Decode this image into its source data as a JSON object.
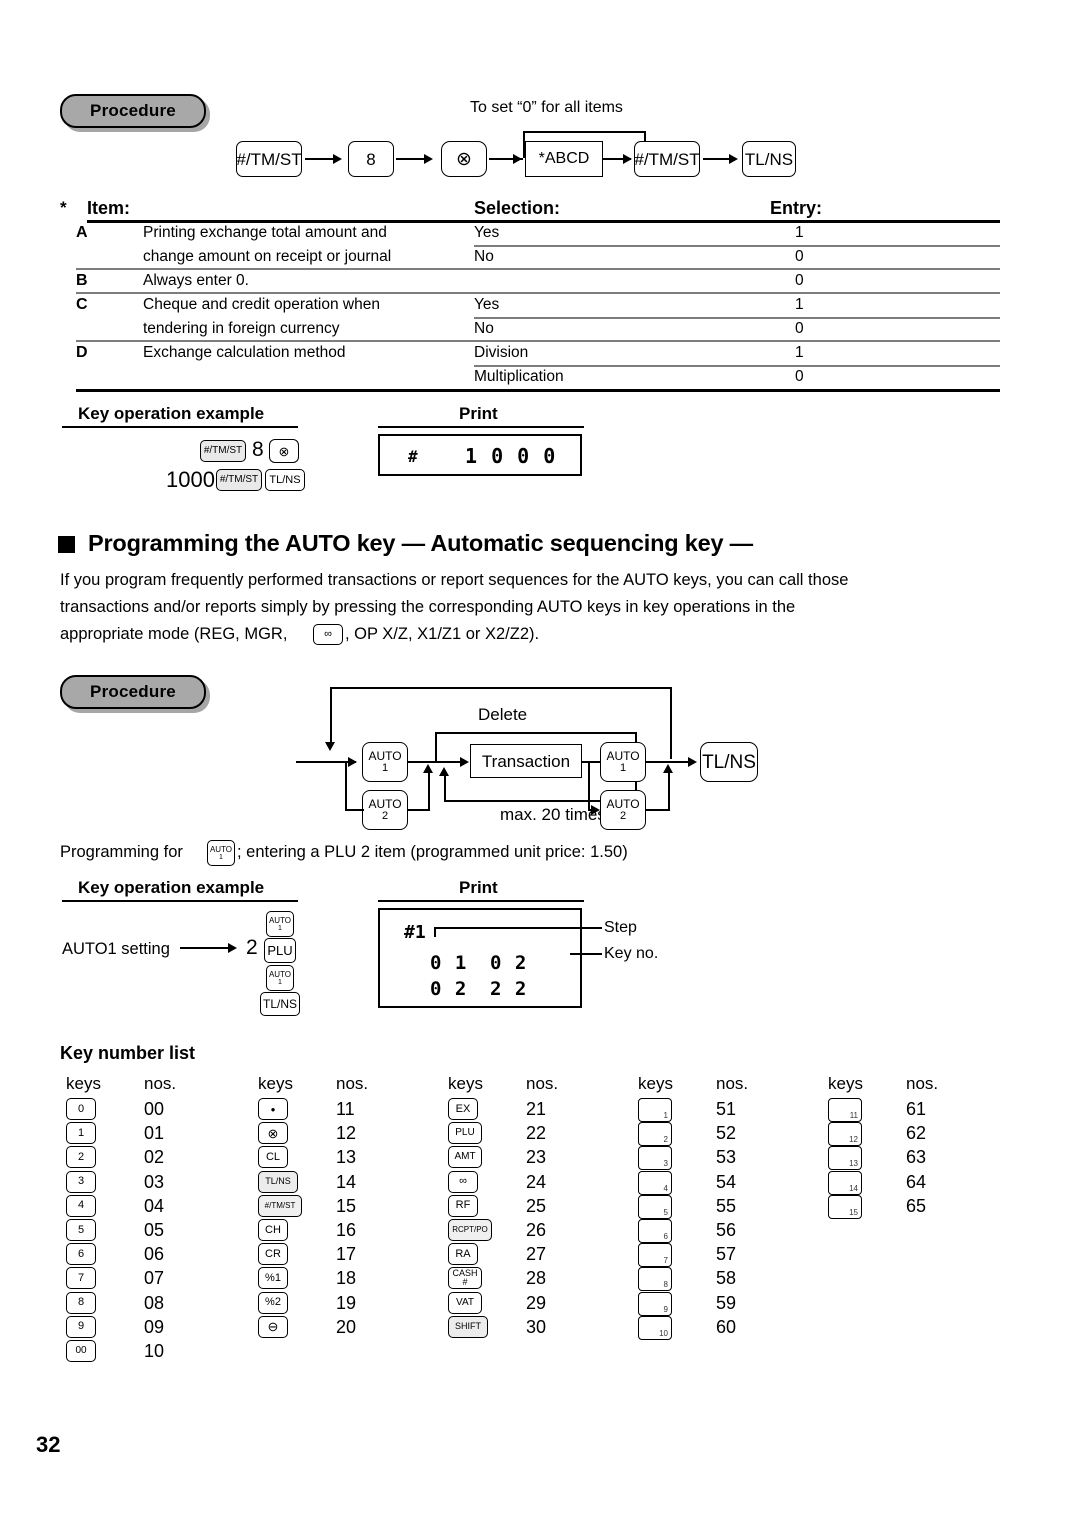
{
  "page": {
    "number": "32"
  },
  "section1": {
    "procedure_label": "Procedure",
    "note_above": "To set “0” for all items",
    "flow": [
      {
        "label": "#/TM/ST",
        "type": "key"
      },
      {
        "label": "8",
        "type": "key"
      },
      {
        "label": "⊗",
        "type": "key"
      },
      {
        "label": "*ABCD",
        "type": "box"
      },
      {
        "label": "#/TM/ST",
        "type": "key"
      },
      {
        "label": "TL/NS",
        "type": "key"
      }
    ],
    "table": {
      "asterisk": "*",
      "headers": [
        "Item:",
        "Selection:",
        "Entry:"
      ],
      "rows": [
        {
          "letter": "A",
          "item": "Printing exchange total amount and",
          "selection": "Yes",
          "entry": "1"
        },
        {
          "letter": "",
          "item": "change amount on receipt or journal",
          "selection": "No",
          "entry": "0"
        },
        {
          "letter": "B",
          "item": "Always enter 0.",
          "selection": "",
          "entry": "0"
        },
        {
          "letter": "C",
          "item": "Cheque and credit operation when",
          "selection": "Yes",
          "entry": "1"
        },
        {
          "letter": "",
          "item": "tendering in foreign currency",
          "selection": "No",
          "entry": "0"
        },
        {
          "letter": "D",
          "item": "Exchange calculation method",
          "selection": "Division",
          "entry": "1"
        },
        {
          "letter": "",
          "item": "",
          "selection": "Multiplication",
          "entry": "0"
        }
      ]
    },
    "example": {
      "key_op_title": "Key operation example",
      "print_title": "Print",
      "keys_line1": [
        "#/TM/ST",
        "8",
        "⊗"
      ],
      "keys_line2_amount": "1000",
      "keys_line2": [
        "#/TM/ST",
        "TL/NS"
      ],
      "print_hash": "#",
      "print_value": "1 0 0 0"
    }
  },
  "section2": {
    "heading": "Programming the AUTO key  — Automatic sequencing key —",
    "body_line1": "If you program frequently performed transactions or report sequences for the AUTO keys, you can call those",
    "body_line2_a": "transactions and/or reports simply by pressing the corresponding AUTO keys in key operations in the",
    "body_line3_a": "appropriate mode (REG, MGR, ",
    "body_line3_mode_icon": "∞",
    "body_line3_b": ", OP X/Z, X1/Z1 or X2/Z2).",
    "procedure_label": "Procedure",
    "flow": {
      "delete_label": "Delete",
      "transaction_label": "Transaction",
      "max_label": "max. 20 times",
      "auto1_top": {
        "l1": "AUTO",
        "l2": "1"
      },
      "auto2_top": {
        "l1": "AUTO",
        "l2": "2"
      },
      "auto1_end": {
        "l1": "AUTO",
        "l2": "1"
      },
      "auto2_end": {
        "l1": "AUTO",
        "l2": "2"
      },
      "tlns": "TL/NS"
    },
    "prog_text_a": "Programming for ",
    "prog_text_icon": {
      "l1": "AUTO",
      "l2": "1"
    },
    "prog_text_b": "; entering a PLU 2 item (programmed unit price: 1.50)",
    "example": {
      "key_op_title": "Key operation example",
      "print_title": "Print",
      "setting_label": "AUTO1 setting",
      "qty": "2",
      "keys": [
        {
          "l1": "AUTO",
          "l2": "1",
          "type": "auto"
        },
        {
          "label": "PLU",
          "type": "key"
        },
        {
          "l1": "AUTO",
          "l2": "1",
          "type": "auto"
        },
        {
          "label": "TL/NS",
          "type": "key"
        }
      ],
      "print_title_line": "#1",
      "print_rows": [
        [
          "0 1",
          "0 2"
        ],
        [
          "0 2",
          "2 2"
        ]
      ],
      "callout_step": "Step",
      "callout_keyno": "Key no."
    }
  },
  "key_number_list": {
    "title": "Key number list",
    "col_headers": [
      "keys",
      "nos."
    ],
    "columns": [
      {
        "entries": [
          {
            "key": "0",
            "style": "sm",
            "no": "00"
          },
          {
            "key": "1",
            "style": "sm",
            "no": "01"
          },
          {
            "key": "2",
            "style": "sm",
            "no": "02"
          },
          {
            "key": "3",
            "style": "sm",
            "no": "03"
          },
          {
            "key": "4",
            "style": "sm",
            "no": "04"
          },
          {
            "key": "5",
            "style": "sm",
            "no": "05"
          },
          {
            "key": "6",
            "style": "sm",
            "no": "06"
          },
          {
            "key": "7",
            "style": "sm",
            "no": "07"
          },
          {
            "key": "8",
            "style": "sm",
            "no": "08"
          },
          {
            "key": "9",
            "style": "sm",
            "no": "09"
          },
          {
            "key": "00",
            "style": "sm",
            "no": "10"
          }
        ]
      },
      {
        "entries": [
          {
            "key": "•",
            "style": "sm",
            "no": "11"
          },
          {
            "key": "⊗",
            "style": "sm",
            "no": "12"
          },
          {
            "key": "CL",
            "style": "sm",
            "no": "13"
          },
          {
            "key": "TL/NS",
            "style": "sm",
            "no": "14"
          },
          {
            "key": "#/TM/ST",
            "style": "sm",
            "no": "15"
          },
          {
            "key": "CH",
            "style": "sm",
            "no": "16"
          },
          {
            "key": "CR",
            "style": "sm",
            "no": "17"
          },
          {
            "key": "%1",
            "style": "sm",
            "no": "18"
          },
          {
            "key": "%2",
            "style": "sm",
            "no": "19"
          },
          {
            "key": "⊖",
            "style": "sm",
            "no": "20"
          }
        ]
      },
      {
        "entries": [
          {
            "key": "EX",
            "style": "sm",
            "no": "21"
          },
          {
            "key": "PLU",
            "style": "sm",
            "no": "22"
          },
          {
            "key": "AMT",
            "style": "sm",
            "no": "23"
          },
          {
            "key": "∞",
            "style": "sm",
            "no": "24"
          },
          {
            "key": "RF",
            "style": "sm",
            "no": "25"
          },
          {
            "key": "RCPT/PO",
            "style": "sm",
            "no": "26"
          },
          {
            "key": "RA",
            "style": "sm",
            "no": "27"
          },
          {
            "key": "CASH\n#",
            "style": "two",
            "no": "28"
          },
          {
            "key": "VAT",
            "style": "sm",
            "no": "29"
          },
          {
            "key": "SHIFT",
            "style": "sm",
            "no": "30"
          }
        ]
      },
      {
        "entries": [
          {
            "key": "",
            "sub": "1",
            "style": "dept",
            "no": "51"
          },
          {
            "key": "",
            "sub": "2",
            "style": "dept",
            "no": "52"
          },
          {
            "key": "",
            "sub": "3",
            "style": "dept",
            "no": "53"
          },
          {
            "key": "",
            "sub": "4",
            "style": "dept",
            "no": "54"
          },
          {
            "key": "",
            "sub": "5",
            "style": "dept",
            "no": "55"
          },
          {
            "key": "",
            "sub": "6",
            "style": "dept",
            "no": "56"
          },
          {
            "key": "",
            "sub": "7",
            "style": "dept",
            "no": "57"
          },
          {
            "key": "",
            "sub": "8",
            "style": "dept",
            "no": "58"
          },
          {
            "key": "",
            "sub": "9",
            "style": "dept",
            "no": "59"
          },
          {
            "key": "",
            "sub": "10",
            "style": "dept",
            "no": "60"
          }
        ]
      },
      {
        "entries": [
          {
            "key": "",
            "sub": "11",
            "style": "dept",
            "no": "61"
          },
          {
            "key": "",
            "sub": "12",
            "style": "dept",
            "no": "62"
          },
          {
            "key": "",
            "sub": "13",
            "style": "dept",
            "no": "63"
          },
          {
            "key": "",
            "sub": "14",
            "style": "dept",
            "no": "64"
          },
          {
            "key": "",
            "sub": "15",
            "style": "dept",
            "no": "65"
          }
        ]
      }
    ]
  }
}
